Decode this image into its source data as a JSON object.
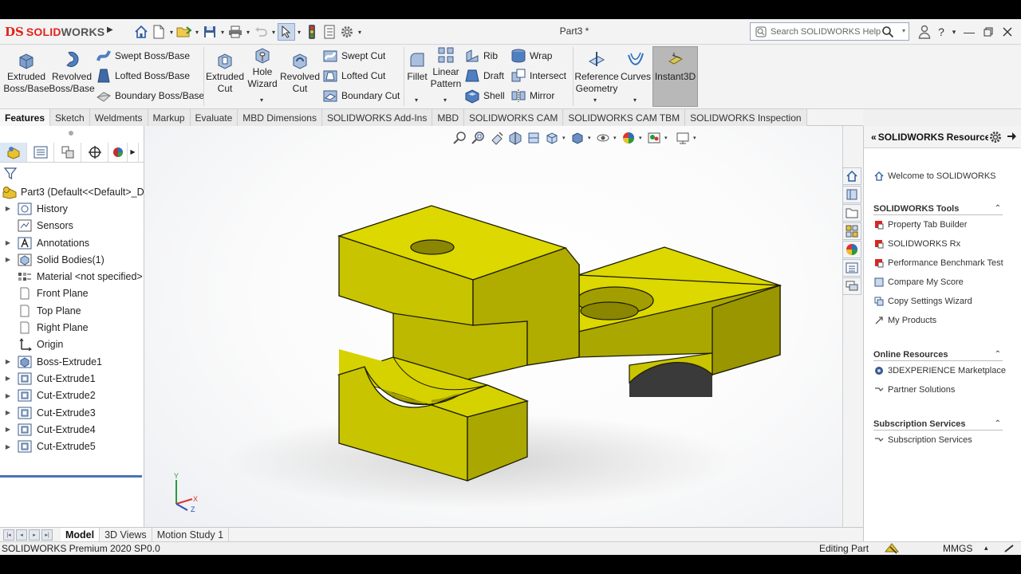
{
  "app": {
    "logo_ds": "DS",
    "logo_solid": "SOLID",
    "logo_works": "WORKS",
    "doc_title": "Part3 *"
  },
  "search": {
    "placeholder": "Search SOLIDWORKS Help"
  },
  "commands": {
    "extruded_boss": "Extruded Boss/Base",
    "revolved_boss": "Revolved Boss/Base",
    "swept_boss": "Swept Boss/Base",
    "lofted_boss": "Lofted Boss/Base",
    "boundary_boss": "Boundary Boss/Base",
    "extruded_cut": "Extruded Cut",
    "hole_wizard": "Hole Wizard",
    "revolved_cut": "Revolved Cut",
    "swept_cut": "Swept Cut",
    "lofted_cut": "Lofted Cut",
    "boundary_cut": "Boundary Cut",
    "fillet": "Fillet",
    "linear_pattern": "Linear Pattern",
    "rib": "Rib",
    "draft": "Draft",
    "shell": "Shell",
    "wrap": "Wrap",
    "intersect": "Intersect",
    "mirror": "Mirror",
    "reference_geometry": "Reference Geometry",
    "curves": "Curves",
    "instant3d": "Instant3D"
  },
  "tabs": [
    "Features",
    "Sketch",
    "Weldments",
    "Markup",
    "Evaluate",
    "MBD Dimensions",
    "SOLIDWORKS Add-Ins",
    "MBD",
    "SOLIDWORKS CAM",
    "SOLIDWORKS CAM TBM",
    "SOLIDWORKS Inspection"
  ],
  "tree": {
    "root": "Part3  (Default<<Default>_Di",
    "items": [
      {
        "label": "History",
        "expandable": true
      },
      {
        "label": "Sensors",
        "expandable": false
      },
      {
        "label": "Annotations",
        "expandable": true
      },
      {
        "label": "Solid Bodies(1)",
        "expandable": true
      },
      {
        "label": "Material <not specified>",
        "expandable": false
      },
      {
        "label": "Front Plane",
        "expandable": false
      },
      {
        "label": "Top Plane",
        "expandable": false
      },
      {
        "label": "Right Plane",
        "expandable": false
      },
      {
        "label": "Origin",
        "expandable": false
      },
      {
        "label": "Boss-Extrude1",
        "expandable": true
      },
      {
        "label": "Cut-Extrude1",
        "expandable": true
      },
      {
        "label": "Cut-Extrude2",
        "expandable": true
      },
      {
        "label": "Cut-Extrude3",
        "expandable": true
      },
      {
        "label": "Cut-Extrude4",
        "expandable": true
      },
      {
        "label": "Cut-Extrude5",
        "expandable": true
      }
    ]
  },
  "triad": {
    "y": "Y",
    "x": "X",
    "z": "Z"
  },
  "resources": {
    "title": "SOLIDWORKS Resources",
    "welcome": "Welcome to SOLIDWORKS",
    "tools_title": "SOLIDWORKS Tools",
    "tools": [
      "Property Tab Builder",
      "SOLIDWORKS Rx",
      "Performance Benchmark Test",
      "Compare My Score",
      "Copy Settings Wizard",
      "My Products"
    ],
    "online_title": "Online Resources",
    "online": [
      "3DEXPERIENCE Marketplace",
      "Partner Solutions"
    ],
    "subscription_title": "Subscription Services",
    "subscription": [
      "Subscription Services"
    ]
  },
  "bottom_tabs": [
    "Model",
    "3D Views",
    "Motion Study 1"
  ],
  "status": {
    "product": "SOLIDWORKS Premium 2020 SP0.0",
    "mode": "Editing Part",
    "units": "MMGS"
  },
  "colors": {
    "part": "#c9c400",
    "accent": "#4a73b5",
    "logo": "#e2231a"
  }
}
